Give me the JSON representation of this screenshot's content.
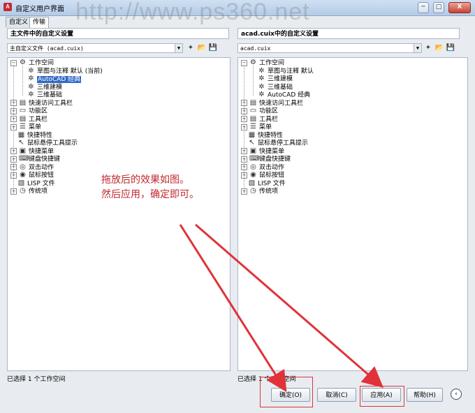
{
  "window": {
    "title": "自定义用户界面",
    "watermark": "http://www.ps360.net",
    "controls": {
      "minimize": "─",
      "maximize": "□",
      "close": "X"
    }
  },
  "tabs": [
    {
      "label": "自定义"
    },
    {
      "label": "传输",
      "active": true
    }
  ],
  "left_panel": {
    "heading": "主文件中的自定义设置",
    "file_select": "主自定义文件 (acad.cuix)",
    "status": "已选择 1 个工作空间",
    "tree": [
      {
        "label": "工作空间",
        "icon": "workspace-icon",
        "level": 0,
        "expander": "−"
      },
      {
        "label": "草图与注释 默认 (当前)",
        "icon": "gear-icon",
        "level": 1,
        "expander": ""
      },
      {
        "label": "AutoCAD 经典",
        "icon": "gear-icon",
        "level": 1,
        "expander": "",
        "selected": true
      },
      {
        "label": "三维建模",
        "icon": "gear-icon",
        "level": 1,
        "expander": ""
      },
      {
        "label": "三维基础",
        "icon": "gear-icon",
        "level": 1,
        "expander": ""
      },
      {
        "label": "快速访问工具栏",
        "icon": "toolbar-icon",
        "level": 0,
        "expander": "+"
      },
      {
        "label": "功能区",
        "icon": "ribbon-icon",
        "level": 0,
        "expander": "+"
      },
      {
        "label": "工具栏",
        "icon": "toolbar-icon",
        "level": 0,
        "expander": "+"
      },
      {
        "label": "菜单",
        "icon": "menu-icon",
        "level": 0,
        "expander": "+"
      },
      {
        "label": "快捷特性",
        "icon": "properties-icon",
        "level": 0,
        "expander": ""
      },
      {
        "label": "鼠标悬停工具提示",
        "icon": "tooltip-icon",
        "level": 0,
        "expander": ""
      },
      {
        "label": "快捷菜单",
        "icon": "shortcut-menu-icon",
        "level": 0,
        "expander": "+"
      },
      {
        "label": "键盘快捷键",
        "icon": "keyboard-icon",
        "level": 0,
        "expander": "+"
      },
      {
        "label": "双击动作",
        "icon": "double-click-icon",
        "level": 0,
        "expander": "+"
      },
      {
        "label": "鼠标按钮",
        "icon": "mouse-icon",
        "level": 0,
        "expander": "+"
      },
      {
        "label": "LISP 文件",
        "icon": "lisp-icon",
        "level": 0,
        "expander": ""
      },
      {
        "label": "传统项",
        "icon": "legacy-icon",
        "level": 0,
        "expander": "+"
      }
    ]
  },
  "right_panel": {
    "heading": "acad.cuix中的自定义设置",
    "file_select": "acad.cuix",
    "status": "已选择 1 个工作空间",
    "tree": [
      {
        "label": "工作空间",
        "icon": "workspace-icon",
        "level": 0,
        "expander": "−"
      },
      {
        "label": "草图与注释 默认",
        "icon": "gear-icon",
        "level": 1,
        "expander": ""
      },
      {
        "label": "三维建模",
        "icon": "gear-icon",
        "level": 1,
        "expander": ""
      },
      {
        "label": "三维基础",
        "icon": "gear-icon",
        "level": 1,
        "expander": ""
      },
      {
        "label": "AutoCAD 经典",
        "icon": "gear-icon",
        "level": 1,
        "expander": ""
      },
      {
        "label": "快速访问工具栏",
        "icon": "toolbar-icon",
        "level": 0,
        "expander": "+"
      },
      {
        "label": "功能区",
        "icon": "ribbon-icon",
        "level": 0,
        "expander": "+"
      },
      {
        "label": "工具栏",
        "icon": "toolbar-icon",
        "level": 0,
        "expander": "+"
      },
      {
        "label": "菜单",
        "icon": "menu-icon",
        "level": 0,
        "expander": "+"
      },
      {
        "label": "快捷特性",
        "icon": "properties-icon",
        "level": 0,
        "expander": ""
      },
      {
        "label": "鼠标悬停工具提示",
        "icon": "tooltip-icon",
        "level": 0,
        "expander": ""
      },
      {
        "label": "快捷菜单",
        "icon": "shortcut-menu-icon",
        "level": 0,
        "expander": "+"
      },
      {
        "label": "键盘快捷键",
        "icon": "keyboard-icon",
        "level": 0,
        "expander": "+"
      },
      {
        "label": "双击动作",
        "icon": "double-click-icon",
        "level": 0,
        "expander": "+"
      },
      {
        "label": "鼠标按钮",
        "icon": "mouse-icon",
        "level": 0,
        "expander": "+"
      },
      {
        "label": "LISP 文件",
        "icon": "lisp-icon",
        "level": 0,
        "expander": ""
      },
      {
        "label": "传统项",
        "icon": "legacy-icon",
        "level": 0,
        "expander": "+"
      }
    ]
  },
  "annotation": {
    "line1": "拖放后的效果如图。",
    "line2": "然后应用，确定即可。",
    "color": "#c0282e"
  },
  "buttons": {
    "ok": "确定(O)",
    "cancel": "取消(C)",
    "apply": "应用(A)",
    "help": "帮助(H)",
    "expand": "‹"
  },
  "colors": {
    "highlight_box": "#e0323a",
    "arrow": "#e0323a",
    "selection": "#3169c6"
  }
}
